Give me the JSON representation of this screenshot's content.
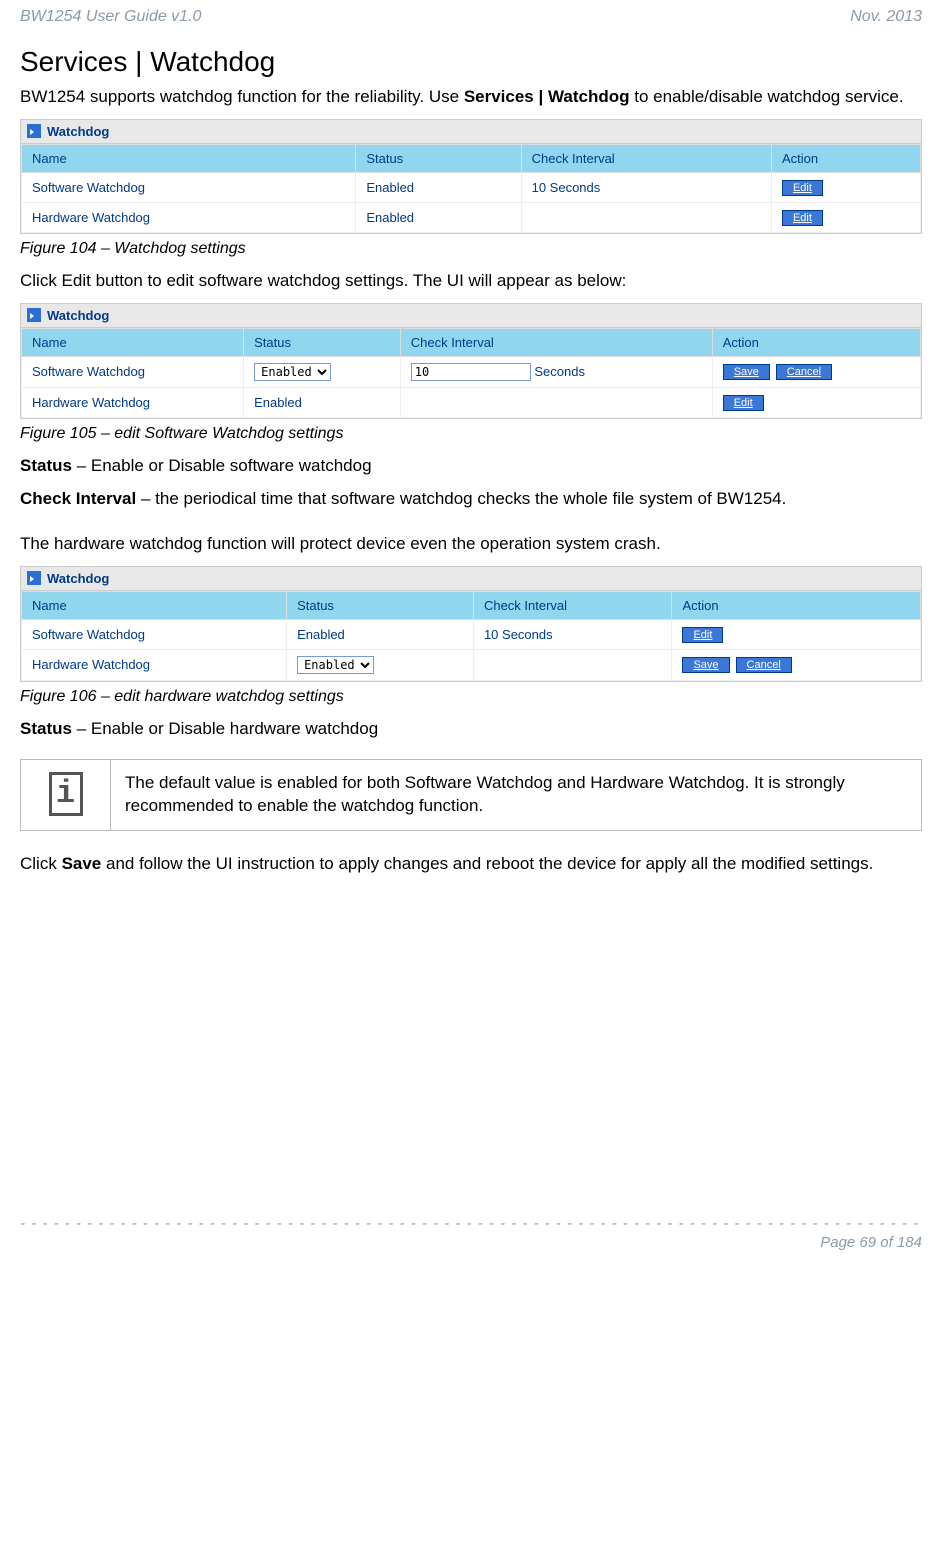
{
  "header": {
    "left": "BW1254 User Guide v1.0",
    "right": "Nov.  2013"
  },
  "title": "Services | Watchdog",
  "intro_pre": "BW1254 supports watchdog function for the reliability. Use ",
  "intro_bold": "Services | Watchdog",
  "intro_post": " to enable/disable watchdog service.",
  "panel_label": "Watchdog",
  "columns": {
    "name": "Name",
    "status": "Status",
    "interval": "Check Interval",
    "action": "Action"
  },
  "rows": {
    "sw_name": "Software Watchdog",
    "hw_name": "Hardware Watchdog",
    "enabled_text": "Enabled",
    "interval_text": "10 Seconds",
    "seconds_suffix": "Seconds",
    "interval_value": "10",
    "select_value": "Enabled"
  },
  "buttons": {
    "edit": "Edit",
    "save": "Save",
    "cancel": "Cancel"
  },
  "captions": {
    "fig104": "Figure 104 – Watchdog settings",
    "fig105": "Figure 105 – edit Software Watchdog settings",
    "fig106": "Figure 106 – edit hardware watchdog settings"
  },
  "text": {
    "click_edit": "Click Edit button to edit software watchdog settings. The UI will appear as below:",
    "status_label": "Status",
    "status_desc": " – Enable or Disable software watchdog",
    "interval_label": "Check Interval",
    "interval_desc": " – the periodical time that software watchdog checks the whole file system of BW1254.",
    "hw_intro": "The hardware watchdog function will protect device even the operation system crash.",
    "status2_desc": " – Enable or Disable hardware watchdog",
    "info": "The default value is enabled for both Software Watchdog and Hardware Watchdog. It is strongly recommended to enable the watchdog function.",
    "save_pre": "Click ",
    "save_bold": "Save",
    "save_post": " and follow the UI instruction to apply changes and reboot the device for apply all the modified settings."
  },
  "footer": {
    "page": "Page 69 of 184"
  }
}
